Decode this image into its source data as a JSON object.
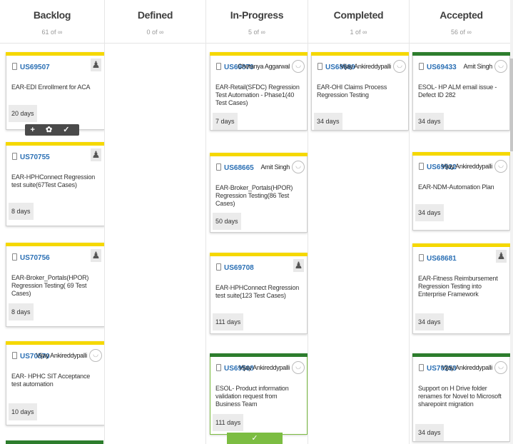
{
  "columns": [
    {
      "title": "Backlog",
      "count": "61 of ∞"
    },
    {
      "title": "Defined",
      "count": "0 of ∞"
    },
    {
      "title": "In-Progress",
      "count": "5 of ∞"
    },
    {
      "title": "Completed",
      "count": "1 of ∞"
    },
    {
      "title": "Accepted",
      "count": "56 of ∞"
    }
  ],
  "cards": {
    "backlog": [
      {
        "id": "US69507",
        "desc": "EAR-EDI Enrollment for ACA",
        "days": "20 days"
      },
      {
        "id": "US70755",
        "desc": "EAR-HPHConnect Regression test suite(67Test Cases)",
        "days": "8 days"
      },
      {
        "id": "US70756",
        "desc": "EAR-Broker_Portals(HPOR) Regression Testing( 69 Test Cases)",
        "days": "8 days"
      },
      {
        "id": "US70570",
        "owner": "Vijay Ankireddypalli",
        "desc": "EAR- HPHC SIT Acceptance test automation",
        "days": "10 days"
      }
    ],
    "inprogress": [
      {
        "id": "US69879",
        "owner": "Chetanya Aggarwal",
        "desc": "EAR-Retail(SFDC) Regression Test Automation - Phase1(40 Test Cases)",
        "days": "7 days"
      },
      {
        "id": "US68665",
        "owner": "Amit Singh",
        "desc": "EAR-Broker_Portals(HPOR) Regression Testing(86 Test Cases)",
        "days": "50 days"
      },
      {
        "id": "US69708",
        "desc": "EAR-HPHConnect Regression test suite(123 Test Cases)",
        "days": "111 days"
      },
      {
        "id": "US69508",
        "owner": "Vijay Ankireddypalli",
        "desc": "ESOL- Product information validation request from Business Team",
        "days": "111 days"
      }
    ],
    "completed": [
      {
        "id": "US68689",
        "owner": "Vijay Ankireddypalli",
        "desc": "EAR-OHI Claims Process Regression Testing",
        "days": "34 days"
      }
    ],
    "accepted": [
      {
        "id": "US69433",
        "owner": "Amit Singh",
        "desc": "ESOL- HP ALM email issue - Defect ID 282",
        "days": "34 days"
      },
      {
        "id": "US69922",
        "owner": "Vijay Ankireddypalli",
        "desc": "EAR-NDM-Automation Plan",
        "days": "34 days"
      },
      {
        "id": "US68681",
        "desc": "EAR-Fitness Reimbursement Regression Testing into Enterprise Framework",
        "days": "34 days"
      },
      {
        "id": "US70253",
        "owner": "Vijay Ankireddypalli",
        "desc": "Support on H Drive folder renames for Novel to Microsoft sharepoint migration",
        "days": "34 days"
      }
    ]
  },
  "toolbar": {
    "icons": "+ ⚙ ✓ ⊘ 💧",
    "label": "+ ✿ ✓ ⊘ ♦"
  },
  "check_tab": {
    "label": "✓"
  },
  "colors": {
    "accent_yellow": "#f5d800",
    "accent_green": "#2d7d2d",
    "link_blue": "#2a6fb4",
    "done_green": "#7cbd42"
  }
}
